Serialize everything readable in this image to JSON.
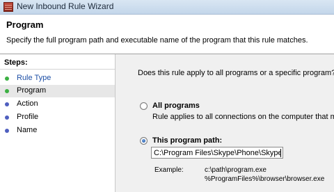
{
  "window": {
    "title": "New Inbound Rule Wizard",
    "icon": "firewall-icon"
  },
  "header": {
    "title": "Program",
    "description": "Specify the full program path and executable name of the program that this rule matches."
  },
  "steps": {
    "heading": "Steps:",
    "items": [
      {
        "label": "Rule Type",
        "state": "done"
      },
      {
        "label": "Program",
        "state": "current"
      },
      {
        "label": "Action",
        "state": "pending"
      },
      {
        "label": "Profile",
        "state": "pending"
      },
      {
        "label": "Name",
        "state": "pending"
      }
    ],
    "colors": {
      "done": "#3cb043",
      "pending": "#4f5fbf"
    }
  },
  "main": {
    "question": "Does this rule apply to all programs or a specific program?",
    "all_programs": {
      "label": "All programs",
      "description": "Rule applies to all connections on the computer that matc",
      "selected": false
    },
    "program_path": {
      "label": "This program path:",
      "selected": true,
      "value": "C:\\Program Files\\Skype\\Phone\\Skype.exe"
    },
    "example": {
      "label": "Example:",
      "lines": [
        "c:\\path\\program.exe",
        "%ProgramFiles%\\browser\\browser.exe"
      ]
    }
  }
}
